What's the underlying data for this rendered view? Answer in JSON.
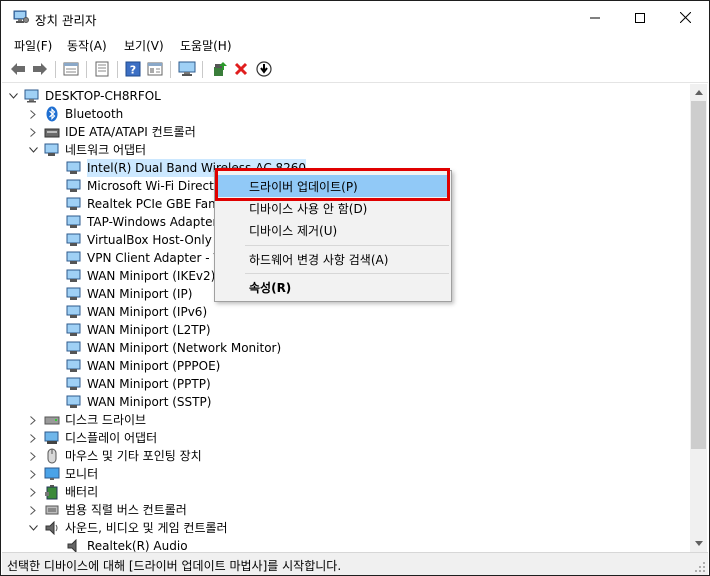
{
  "window": {
    "title": "장치 관리자",
    "icon": "device-manager-icon"
  },
  "menu": [
    {
      "label": "파일(F)"
    },
    {
      "label": "동작(A)"
    },
    {
      "label": "보기(V)"
    },
    {
      "label": "도움말(H)"
    }
  ],
  "toolbar": {
    "buttons": [
      "back-icon",
      "forward-icon",
      "properties-icon",
      "list-icon",
      "help-icon",
      "view-icon",
      "monitor-icon",
      "update-driver-icon",
      "uninstall-icon",
      "download-icon"
    ]
  },
  "tree": {
    "root": "DESKTOP-CH8RFOL",
    "categories": [
      {
        "label": "Bluetooth"
      },
      {
        "label": "IDE ATA/ATAPI 컨트롤러"
      },
      {
        "label": "네트워크 어댑터"
      }
    ],
    "network_adapters": [
      "Intel(R) Dual Band Wireless-AC 8260",
      "Microsoft Wi-Fi Direct V",
      "Realtek PCIe GBE Family",
      "TAP-Windows Adapter V",
      "VirtualBox Host-Only Et",
      "VPN Client Adapter - V",
      "WAN Miniport (IKEv2)",
      "WAN Miniport (IP)",
      "WAN Miniport (IPv6)",
      "WAN Miniport (L2TP)",
      "WAN Miniport (Network Monitor)",
      "WAN Miniport (PPPOE)",
      "WAN Miniport (PPTP)",
      "WAN Miniport (SSTP)"
    ],
    "more_categories": [
      "디스크 드라이브",
      "디스플레이 어댑터",
      "마우스 및 기타 포인팅 장치",
      "모니터",
      "배터리",
      "범용 직렬 버스 컨트롤러",
      "사운드, 비디오 및 게임 컨트롤러"
    ],
    "sound_child": "Realtek(R) Audio"
  },
  "context_menu": {
    "items": [
      {
        "label": "드라이버 업데이트(P)",
        "highlighted": true
      },
      {
        "label": "디바이스 사용 안 함(D)"
      },
      {
        "label": "디바이스 제거(U)"
      },
      {
        "label": "하드웨어 변경 사항 검색(A)"
      },
      {
        "label": "속성(R)",
        "bold": true
      }
    ]
  },
  "status": {
    "text": "선택한 디바이스에 대해 [드라이버 업데이트 마법사]를 시작합니다."
  },
  "colors": {
    "highlight": "#91c9f7",
    "red_box": "#e00000",
    "selection": "#cce8ff"
  }
}
